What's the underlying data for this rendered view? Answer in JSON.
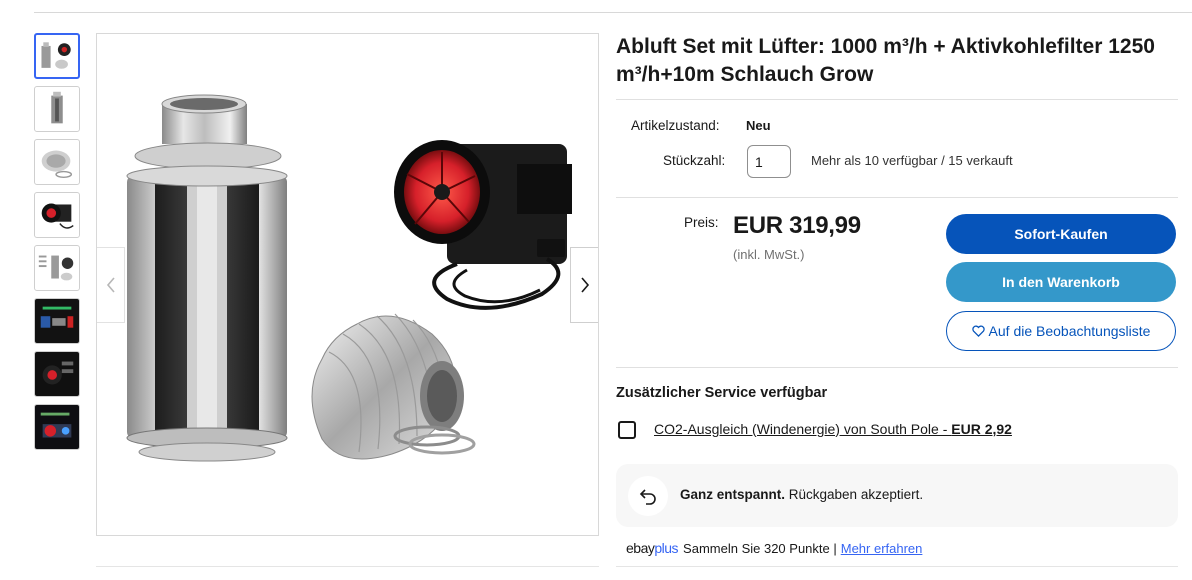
{
  "listing": {
    "title": "Abluft Set mit Lüfter: 1000 m³/h + Aktivkohlefilter 1250 m³/h+10m Schlauch Grow"
  },
  "details": {
    "condition_label": "Artikelzustand:",
    "condition_value": "Neu",
    "quantity_label": "Stückzahl:",
    "quantity_value": "1",
    "availability": "Mehr als 10 verfügbar / 15 verkauft"
  },
  "pricing": {
    "price_label": "Preis:",
    "price": "EUR 319,99",
    "vat_note": "(inkl. MwSt.)"
  },
  "actions": {
    "buy_now": "Sofort-Kaufen",
    "add_to_cart": "In den Warenkorb",
    "watchlist": "Auf die Beobachtungsliste"
  },
  "service": {
    "title": "Zusätzlicher Service verfügbar",
    "option_text": "CO2-Ausgleich (Windenergie) von South Pole - ",
    "option_price": "EUR 2,92"
  },
  "returns": {
    "headline": "Ganz entspannt.",
    "text": " Rückgaben akzeptiert."
  },
  "ebay_plus": {
    "logo_ebay": "ebay",
    "logo_plus": "plus",
    "text": "Sammeln Sie 320 Punkte |",
    "link": "Mehr erfahren"
  },
  "gallery": {
    "thumbnail_count": 8,
    "active_index": 0
  },
  "colors": {
    "primary_blue": "#0654ba",
    "cart_blue": "#3498ca",
    "link_blue": "#3665f3",
    "fan_red": "#d6202a"
  }
}
